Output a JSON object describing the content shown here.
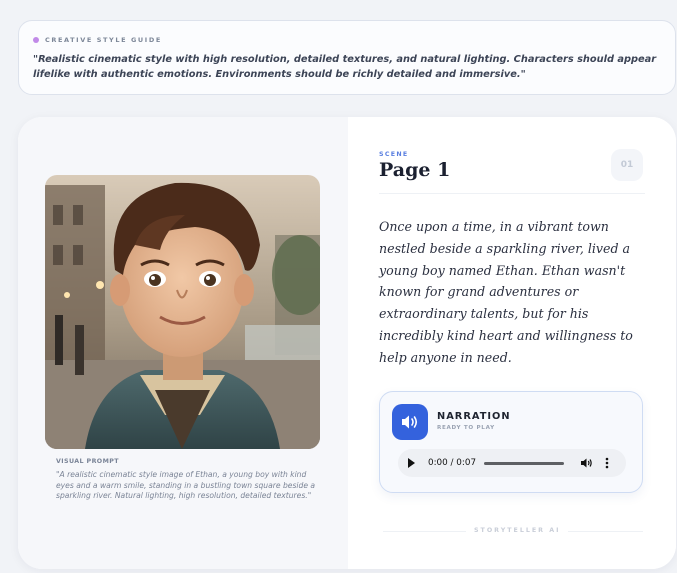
{
  "style_guide": {
    "title": "CREATIVE STYLE GUIDE",
    "text": "\"Realistic cinematic style with high resolution, detailed textures, and natural lighting. Characters should appear lifelike with authentic emotions. Environments should be richly detailed and immersive.\""
  },
  "visual_prompt": {
    "label": "VISUAL PROMPT",
    "text": "\"A realistic cinematic style image of Ethan, a young boy with kind eyes and a warm smile, standing in a bustling town square beside a sparkling river. Natural lighting, high resolution, detailed textures.\""
  },
  "scene": {
    "label": "SCENE",
    "title": "Page 1",
    "number": "01",
    "story": "Once upon a time, in a vibrant town nestled beside a sparkling river, lived a young boy named Ethan. Ethan wasn't known for grand adventures or extraordinary talents, but for his incredibly kind heart and willingness to help anyone in need."
  },
  "narration": {
    "title": "NARRATION",
    "status": "READY TO PLAY",
    "time": "0:00 / 0:07",
    "icon": "speaker-icon"
  },
  "footer": {
    "brand": "STORYTELLER AI"
  },
  "colors": {
    "accent": "#3462dd",
    "dot": "#c18ae8"
  }
}
